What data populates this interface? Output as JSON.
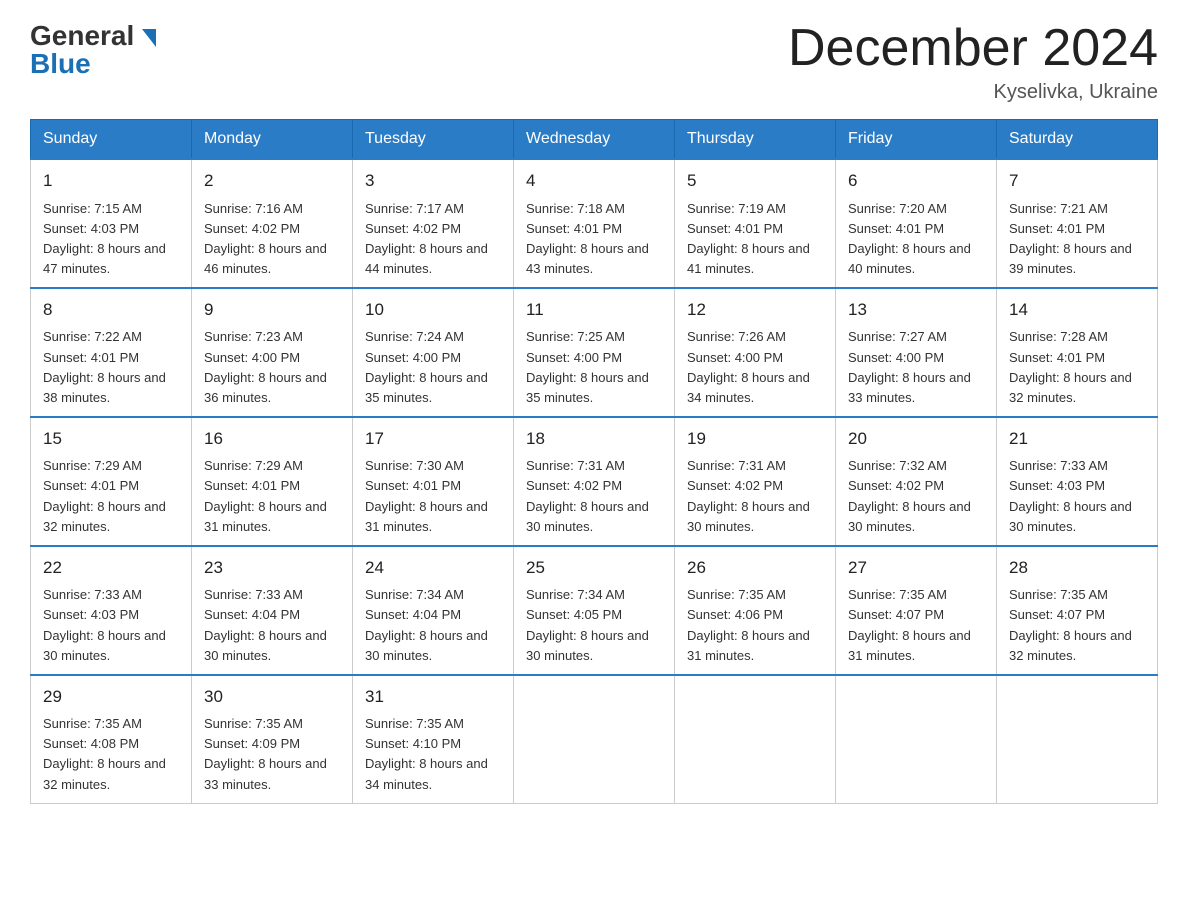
{
  "logo": {
    "general": "General",
    "blue": "Blue"
  },
  "title": "December 2024",
  "location": "Kyselivka, Ukraine",
  "days_of_week": [
    "Sunday",
    "Monday",
    "Tuesday",
    "Wednesday",
    "Thursday",
    "Friday",
    "Saturday"
  ],
  "weeks": [
    [
      {
        "day": "1",
        "sunrise": "7:15 AM",
        "sunset": "4:03 PM",
        "daylight": "8 hours and 47 minutes."
      },
      {
        "day": "2",
        "sunrise": "7:16 AM",
        "sunset": "4:02 PM",
        "daylight": "8 hours and 46 minutes."
      },
      {
        "day": "3",
        "sunrise": "7:17 AM",
        "sunset": "4:02 PM",
        "daylight": "8 hours and 44 minutes."
      },
      {
        "day": "4",
        "sunrise": "7:18 AM",
        "sunset": "4:01 PM",
        "daylight": "8 hours and 43 minutes."
      },
      {
        "day": "5",
        "sunrise": "7:19 AM",
        "sunset": "4:01 PM",
        "daylight": "8 hours and 41 minutes."
      },
      {
        "day": "6",
        "sunrise": "7:20 AM",
        "sunset": "4:01 PM",
        "daylight": "8 hours and 40 minutes."
      },
      {
        "day": "7",
        "sunrise": "7:21 AM",
        "sunset": "4:01 PM",
        "daylight": "8 hours and 39 minutes."
      }
    ],
    [
      {
        "day": "8",
        "sunrise": "7:22 AM",
        "sunset": "4:01 PM",
        "daylight": "8 hours and 38 minutes."
      },
      {
        "day": "9",
        "sunrise": "7:23 AM",
        "sunset": "4:00 PM",
        "daylight": "8 hours and 36 minutes."
      },
      {
        "day": "10",
        "sunrise": "7:24 AM",
        "sunset": "4:00 PM",
        "daylight": "8 hours and 35 minutes."
      },
      {
        "day": "11",
        "sunrise": "7:25 AM",
        "sunset": "4:00 PM",
        "daylight": "8 hours and 35 minutes."
      },
      {
        "day": "12",
        "sunrise": "7:26 AM",
        "sunset": "4:00 PM",
        "daylight": "8 hours and 34 minutes."
      },
      {
        "day": "13",
        "sunrise": "7:27 AM",
        "sunset": "4:00 PM",
        "daylight": "8 hours and 33 minutes."
      },
      {
        "day": "14",
        "sunrise": "7:28 AM",
        "sunset": "4:01 PM",
        "daylight": "8 hours and 32 minutes."
      }
    ],
    [
      {
        "day": "15",
        "sunrise": "7:29 AM",
        "sunset": "4:01 PM",
        "daylight": "8 hours and 32 minutes."
      },
      {
        "day": "16",
        "sunrise": "7:29 AM",
        "sunset": "4:01 PM",
        "daylight": "8 hours and 31 minutes."
      },
      {
        "day": "17",
        "sunrise": "7:30 AM",
        "sunset": "4:01 PM",
        "daylight": "8 hours and 31 minutes."
      },
      {
        "day": "18",
        "sunrise": "7:31 AM",
        "sunset": "4:02 PM",
        "daylight": "8 hours and 30 minutes."
      },
      {
        "day": "19",
        "sunrise": "7:31 AM",
        "sunset": "4:02 PM",
        "daylight": "8 hours and 30 minutes."
      },
      {
        "day": "20",
        "sunrise": "7:32 AM",
        "sunset": "4:02 PM",
        "daylight": "8 hours and 30 minutes."
      },
      {
        "day": "21",
        "sunrise": "7:33 AM",
        "sunset": "4:03 PM",
        "daylight": "8 hours and 30 minutes."
      }
    ],
    [
      {
        "day": "22",
        "sunrise": "7:33 AM",
        "sunset": "4:03 PM",
        "daylight": "8 hours and 30 minutes."
      },
      {
        "day": "23",
        "sunrise": "7:33 AM",
        "sunset": "4:04 PM",
        "daylight": "8 hours and 30 minutes."
      },
      {
        "day": "24",
        "sunrise": "7:34 AM",
        "sunset": "4:04 PM",
        "daylight": "8 hours and 30 minutes."
      },
      {
        "day": "25",
        "sunrise": "7:34 AM",
        "sunset": "4:05 PM",
        "daylight": "8 hours and 30 minutes."
      },
      {
        "day": "26",
        "sunrise": "7:35 AM",
        "sunset": "4:06 PM",
        "daylight": "8 hours and 31 minutes."
      },
      {
        "day": "27",
        "sunrise": "7:35 AM",
        "sunset": "4:07 PM",
        "daylight": "8 hours and 31 minutes."
      },
      {
        "day": "28",
        "sunrise": "7:35 AM",
        "sunset": "4:07 PM",
        "daylight": "8 hours and 32 minutes."
      }
    ],
    [
      {
        "day": "29",
        "sunrise": "7:35 AM",
        "sunset": "4:08 PM",
        "daylight": "8 hours and 32 minutes."
      },
      {
        "day": "30",
        "sunrise": "7:35 AM",
        "sunset": "4:09 PM",
        "daylight": "8 hours and 33 minutes."
      },
      {
        "day": "31",
        "sunrise": "7:35 AM",
        "sunset": "4:10 PM",
        "daylight": "8 hours and 34 minutes."
      },
      null,
      null,
      null,
      null
    ]
  ],
  "labels": {
    "sunrise": "Sunrise:",
    "sunset": "Sunset:",
    "daylight": "Daylight:"
  }
}
